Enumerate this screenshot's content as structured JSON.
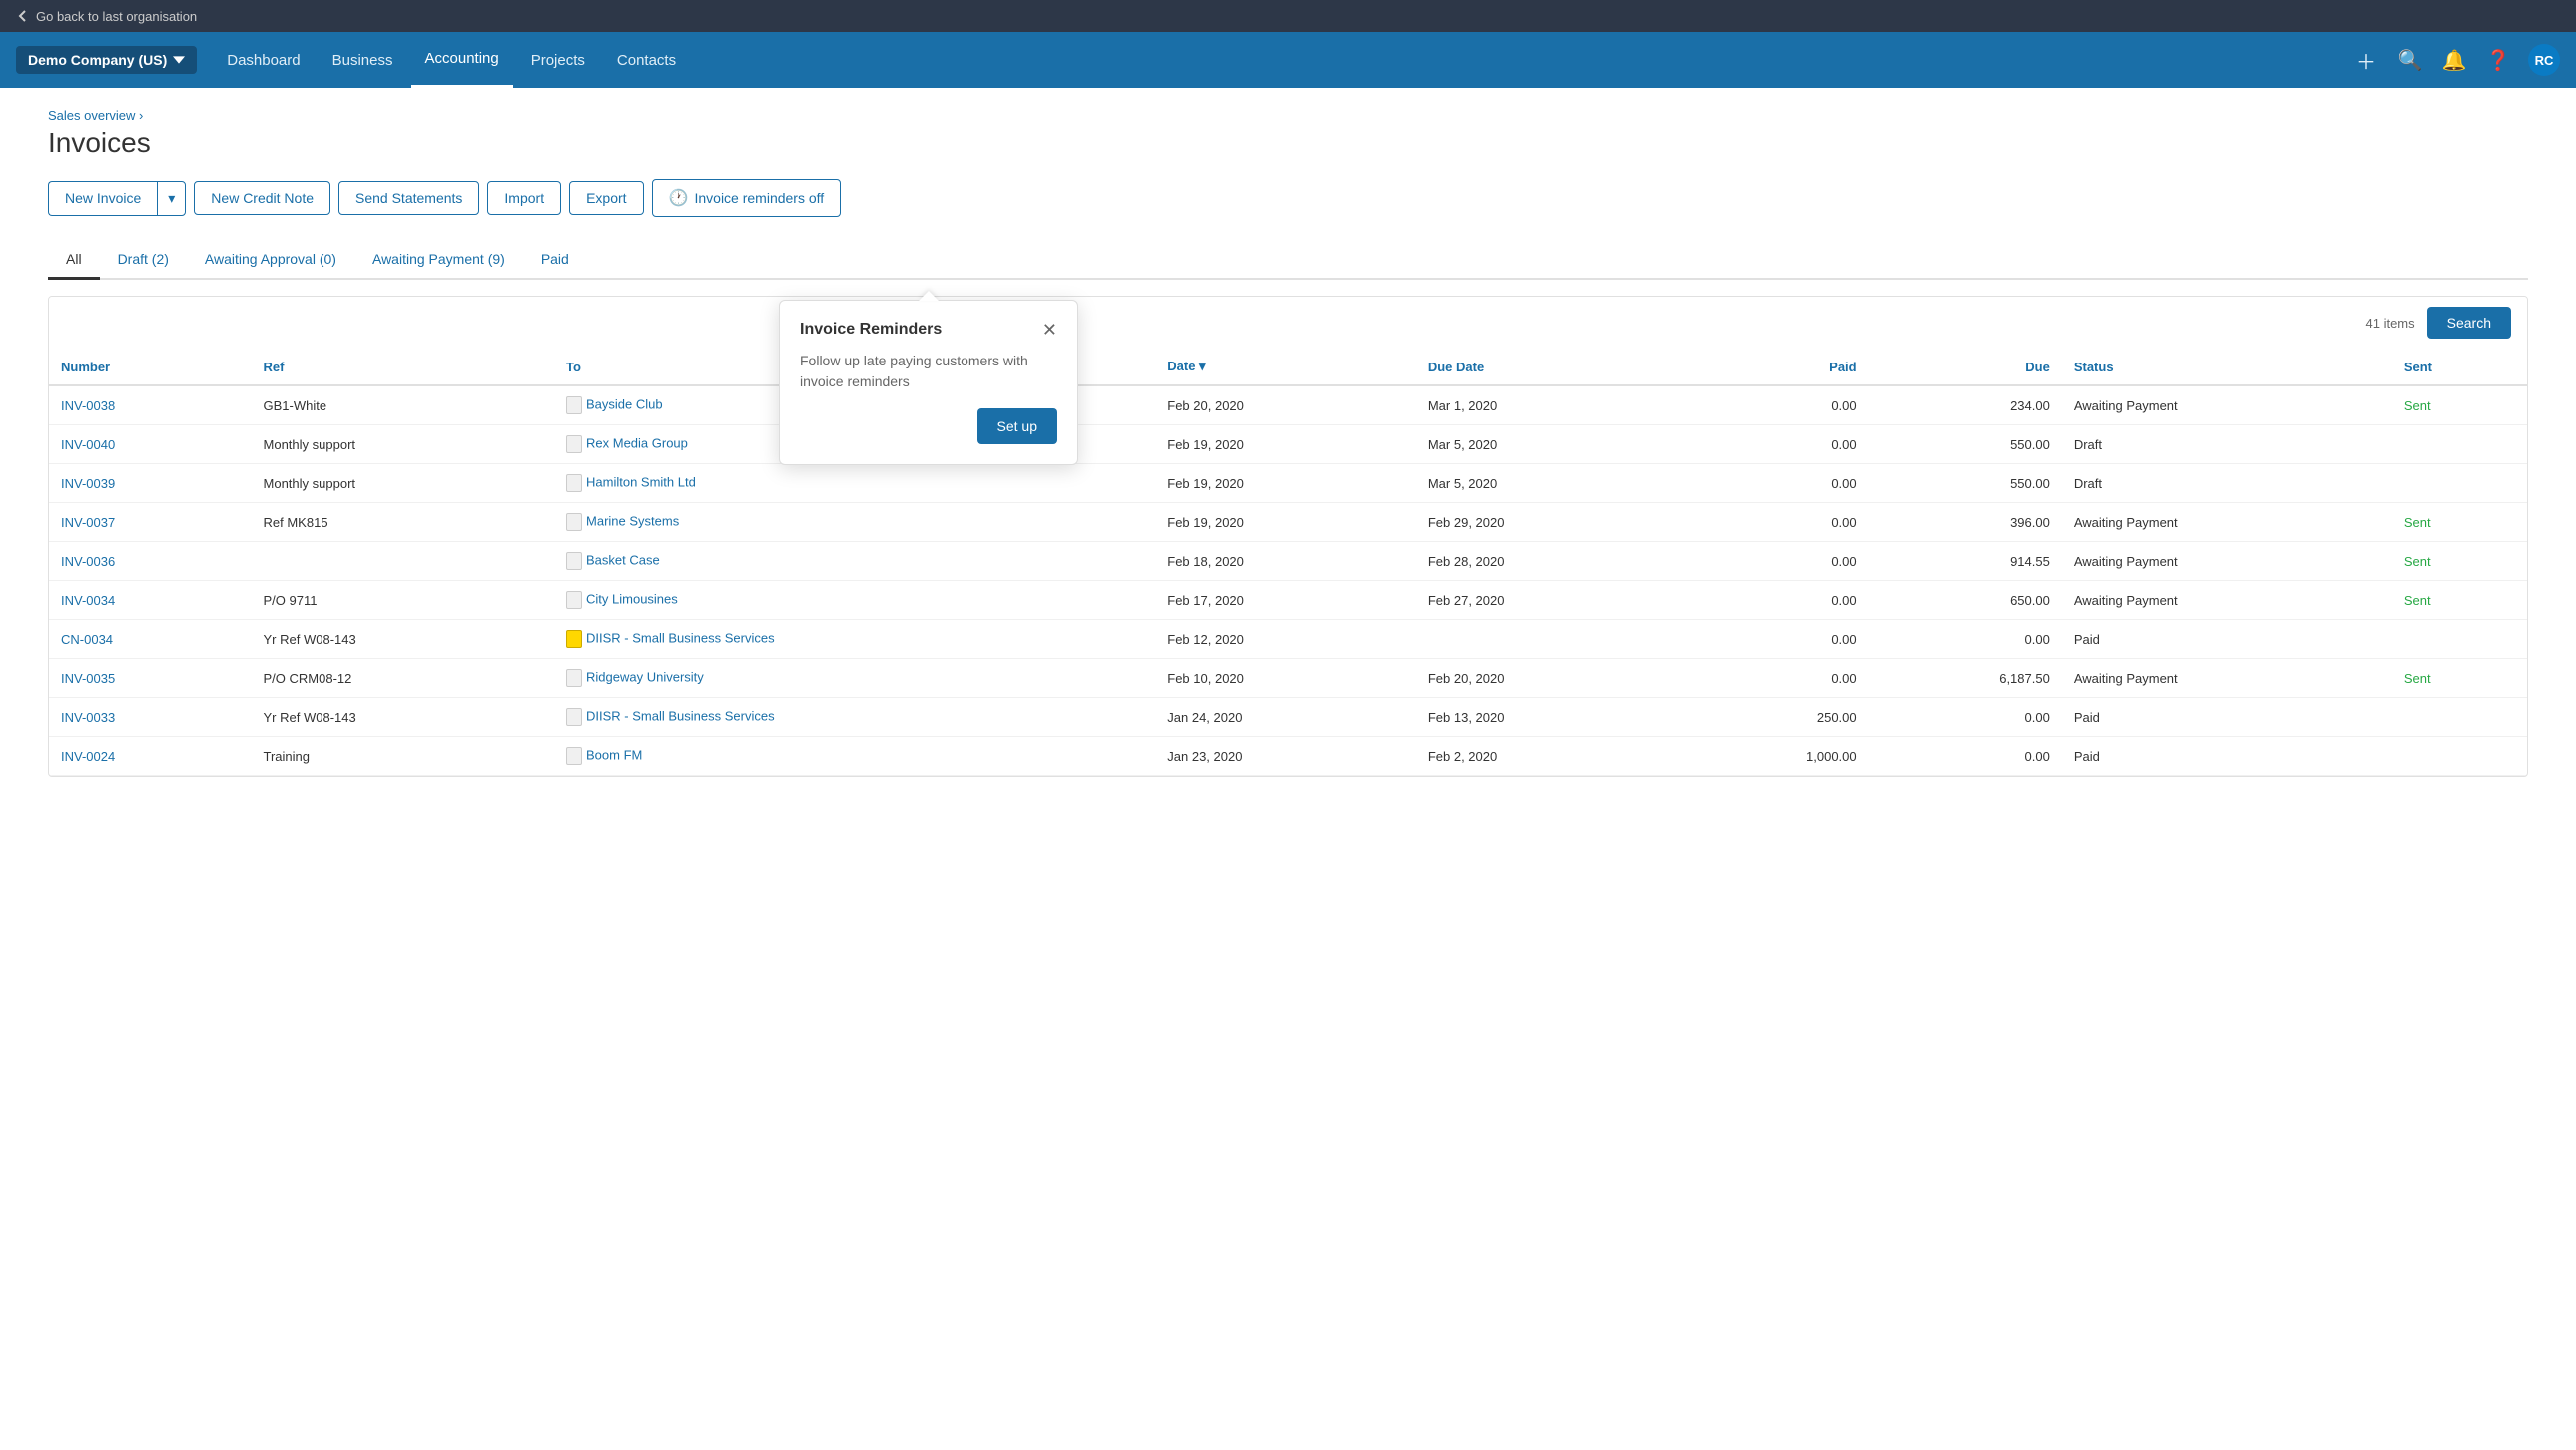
{
  "topbar": {
    "back_label": "Go back to last organisation"
  },
  "navbar": {
    "brand_label": "Demo Company (US)",
    "links": [
      {
        "id": "dashboard",
        "label": "Dashboard",
        "active": false
      },
      {
        "id": "business",
        "label": "Business",
        "active": false
      },
      {
        "id": "accounting",
        "label": "Accounting",
        "active": true
      },
      {
        "id": "projects",
        "label": "Projects",
        "active": false
      },
      {
        "id": "contacts",
        "label": "Contacts",
        "active": false
      }
    ],
    "avatar_initials": "RC"
  },
  "page": {
    "breadcrumb": "Sales overview ›",
    "title": "Invoices"
  },
  "actions": {
    "new_invoice": "New Invoice",
    "new_credit_note": "New Credit Note",
    "send_statements": "Send Statements",
    "import": "Import",
    "export": "Export",
    "invoice_reminders": "Invoice reminders off"
  },
  "tabs": [
    {
      "id": "all",
      "label": "All",
      "count": "",
      "active": true
    },
    {
      "id": "draft",
      "label": "Draft",
      "count": "(2)",
      "active": false
    },
    {
      "id": "awaiting_approval",
      "label": "Awaiting Approval",
      "count": "(0)",
      "active": false
    },
    {
      "id": "awaiting_payment",
      "label": "Awaiting Payment",
      "count": "(9)",
      "active": false
    },
    {
      "id": "paid",
      "label": "Paid",
      "count": "",
      "active": false
    }
  ],
  "table": {
    "items_count": "41 items",
    "search_label": "Search",
    "columns": [
      "Number",
      "Ref",
      "To",
      "Date ▾",
      "Due Date",
      "Paid",
      "Due",
      "Status",
      "Sent"
    ],
    "rows": [
      {
        "number": "INV-0038",
        "ref": "GB1-White",
        "to": "Bayside Club",
        "date": "Feb 20, 2020",
        "due_date": "Mar 1, 2020",
        "paid": "0.00",
        "due": "234.00",
        "status": "Awaiting Payment",
        "sent": "Sent",
        "icon": "normal"
      },
      {
        "number": "INV-0040",
        "ref": "Monthly support",
        "to": "Rex Media Group",
        "date": "Feb 19, 2020",
        "due_date": "Mar 5, 2020",
        "paid": "0.00",
        "due": "550.00",
        "status": "Draft",
        "sent": "",
        "icon": "normal"
      },
      {
        "number": "INV-0039",
        "ref": "Monthly support",
        "to": "Hamilton Smith Ltd",
        "date": "Feb 19, 2020",
        "due_date": "Mar 5, 2020",
        "paid": "0.00",
        "due": "550.00",
        "status": "Draft",
        "sent": "",
        "icon": "normal"
      },
      {
        "number": "INV-0037",
        "ref": "Ref MK815",
        "to": "Marine Systems",
        "date": "Feb 19, 2020",
        "due_date": "Feb 29, 2020",
        "paid": "0.00",
        "due": "396.00",
        "status": "Awaiting Payment",
        "sent": "Sent",
        "icon": "normal"
      },
      {
        "number": "INV-0036",
        "ref": "",
        "to": "Basket Case",
        "date": "Feb 18, 2020",
        "due_date": "Feb 28, 2020",
        "paid": "0.00",
        "due": "914.55",
        "status": "Awaiting Payment",
        "sent": "Sent",
        "icon": "normal"
      },
      {
        "number": "INV-0034",
        "ref": "P/O 9711",
        "to": "City Limousines",
        "date": "Feb 17, 2020",
        "due_date": "Feb 27, 2020",
        "paid": "0.00",
        "due": "650.00",
        "status": "Awaiting Payment",
        "sent": "Sent",
        "icon": "normal"
      },
      {
        "number": "CN-0034",
        "ref": "Yr Ref W08-143",
        "to": "DIISR - Small Business Services",
        "date": "Feb 12, 2020",
        "due_date": "",
        "paid": "0.00",
        "due": "0.00",
        "status": "Paid",
        "sent": "",
        "icon": "credit"
      },
      {
        "number": "INV-0035",
        "ref": "P/O CRM08-12",
        "to": "Ridgeway University",
        "date": "Feb 10, 2020",
        "due_date": "Feb 20, 2020",
        "paid": "0.00",
        "due": "6,187.50",
        "status": "Awaiting Payment",
        "sent": "Sent",
        "icon": "normal"
      },
      {
        "number": "INV-0033",
        "ref": "Yr Ref W08-143",
        "to": "DIISR - Small Business Services",
        "date": "Jan 24, 2020",
        "due_date": "Feb 13, 2020",
        "paid": "250.00",
        "due": "0.00",
        "status": "Paid",
        "sent": "",
        "icon": "normal"
      },
      {
        "number": "INV-0024",
        "ref": "Training",
        "to": "Boom FM",
        "date": "Jan 23, 2020",
        "due_date": "Feb 2, 2020",
        "paid": "1,000.00",
        "due": "0.00",
        "status": "Paid",
        "sent": "",
        "icon": "normal"
      }
    ]
  },
  "popup": {
    "title": "Invoice Reminders",
    "body": "Follow up late paying customers with invoice reminders",
    "setup_label": "Set up"
  }
}
